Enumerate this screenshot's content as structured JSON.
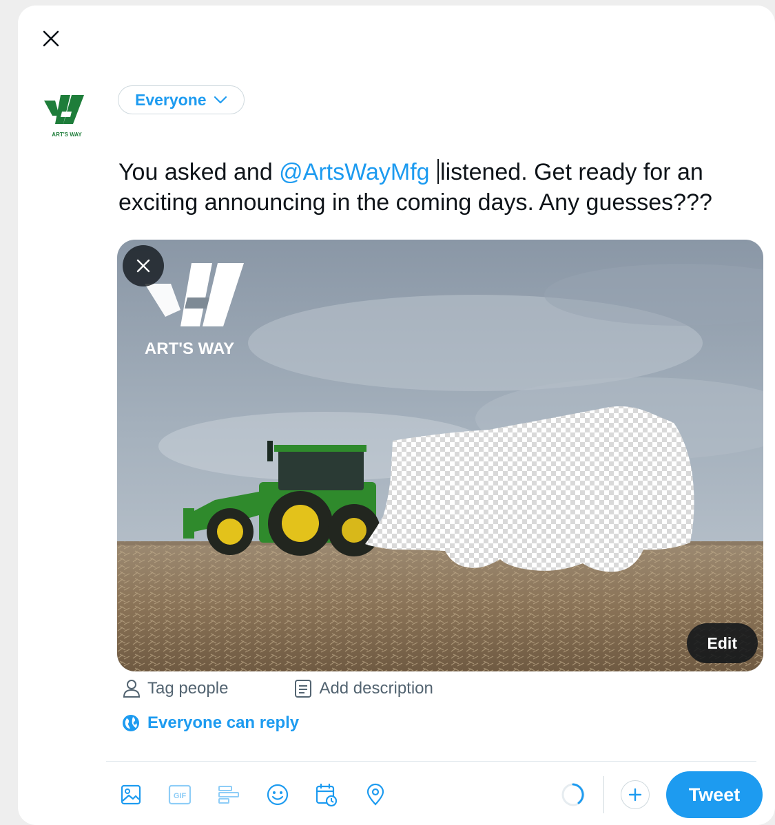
{
  "composer": {
    "audience_label": "Everyone",
    "text_before": "You asked and ",
    "mention": "@ArtsWayMfg",
    "text_after": "listened. Get ready for an exciting announcing in the coming days. Any guesses???",
    "avatar_caption": "ART'S WAY"
  },
  "media": {
    "logo_text": "ART'S WAY",
    "edit_label": "Edit"
  },
  "media_actions": {
    "tag_people": "Tag people",
    "add_description": "Add description"
  },
  "reply": {
    "label": "Everyone can reply"
  },
  "toolbar": {
    "icons": [
      "image-icon",
      "gif-icon",
      "poll-icon",
      "emoji-icon",
      "schedule-icon",
      "location-icon"
    ],
    "gif_label": "GIF",
    "tweet_label": "Tweet"
  },
  "colors": {
    "accent": "#1d9bf0",
    "brand_green": "#1e7d3a",
    "text": "#0f1419",
    "muted": "#536471"
  }
}
